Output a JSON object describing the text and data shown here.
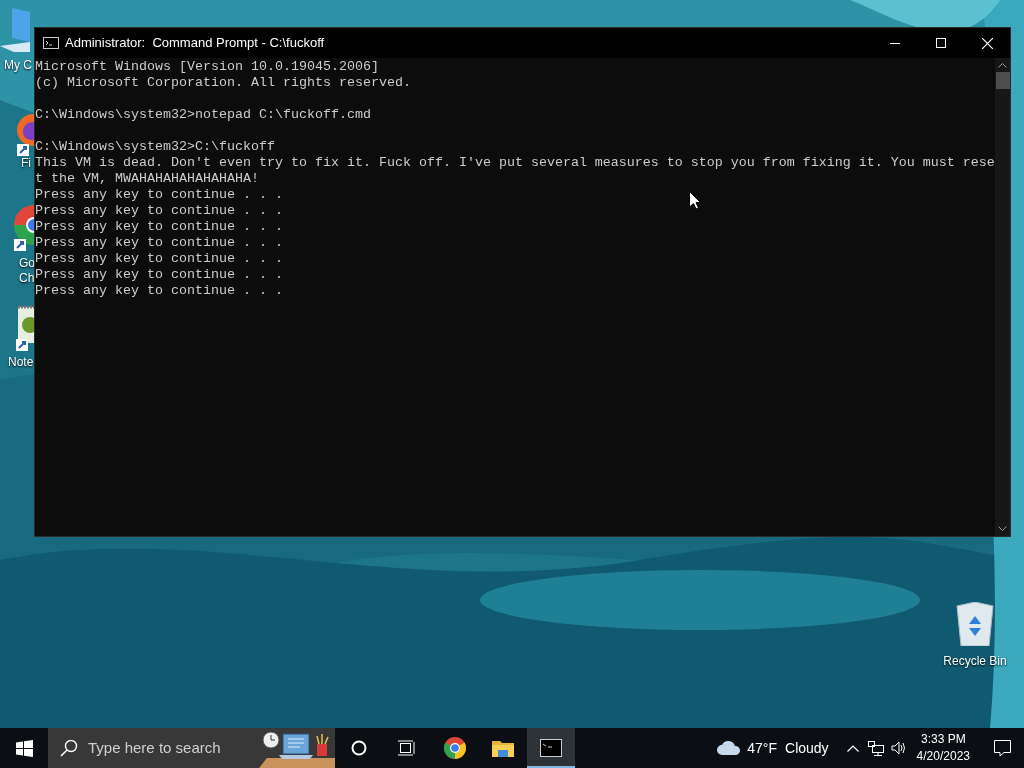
{
  "desktop_icons": [
    {
      "kind": "computer",
      "label_lines": [
        "My C"
      ]
    },
    {
      "kind": "firefox",
      "label_lines": [
        "Fi"
      ]
    },
    {
      "kind": "chrome",
      "label_lines": [
        "Go",
        "Ch"
      ]
    },
    {
      "kind": "notepad",
      "label_lines": [
        "Note"
      ]
    },
    {
      "kind": "recycle",
      "label_lines": [
        "Recycle Bin"
      ]
    }
  ],
  "window": {
    "title": "Administrator:  Command Prompt - C:\\fuckoff",
    "console_blocks": [
      [
        "Microsoft Windows [Version 10.0.19045.2006]",
        "(c) Microsoft Corporation. All rights reserved."
      ],
      [
        "C:\\Windows\\system32>notepad C:\\fuckoff.cmd"
      ],
      [
        "C:\\Windows\\system32>C:\\fuckoff",
        "This VM is dead. Don't even try to fix it. Fuck off. I've put several measures to stop you from fixing it. You must rese",
        "t the VM, MWAHAHAHAHAHAHAHA!",
        "Press any key to continue . . .",
        "Press any key to continue . . .",
        "Press any key to continue . . .",
        "Press any key to continue . . .",
        "Press any key to continue . . .",
        "Press any key to continue . . .",
        "Press any key to continue . . ."
      ]
    ]
  },
  "taskbar": {
    "search": {
      "placeholder": "Type here to search"
    },
    "apps": [
      {
        "kind": "chrome",
        "selected": false
      },
      {
        "kind": "folder",
        "selected": false
      },
      {
        "kind": "console",
        "selected": true
      }
    ],
    "weather": {
      "temperature": "47°F",
      "condition": "Cloudy"
    },
    "time": "3:33 PM",
    "date": "4/20/2023"
  }
}
